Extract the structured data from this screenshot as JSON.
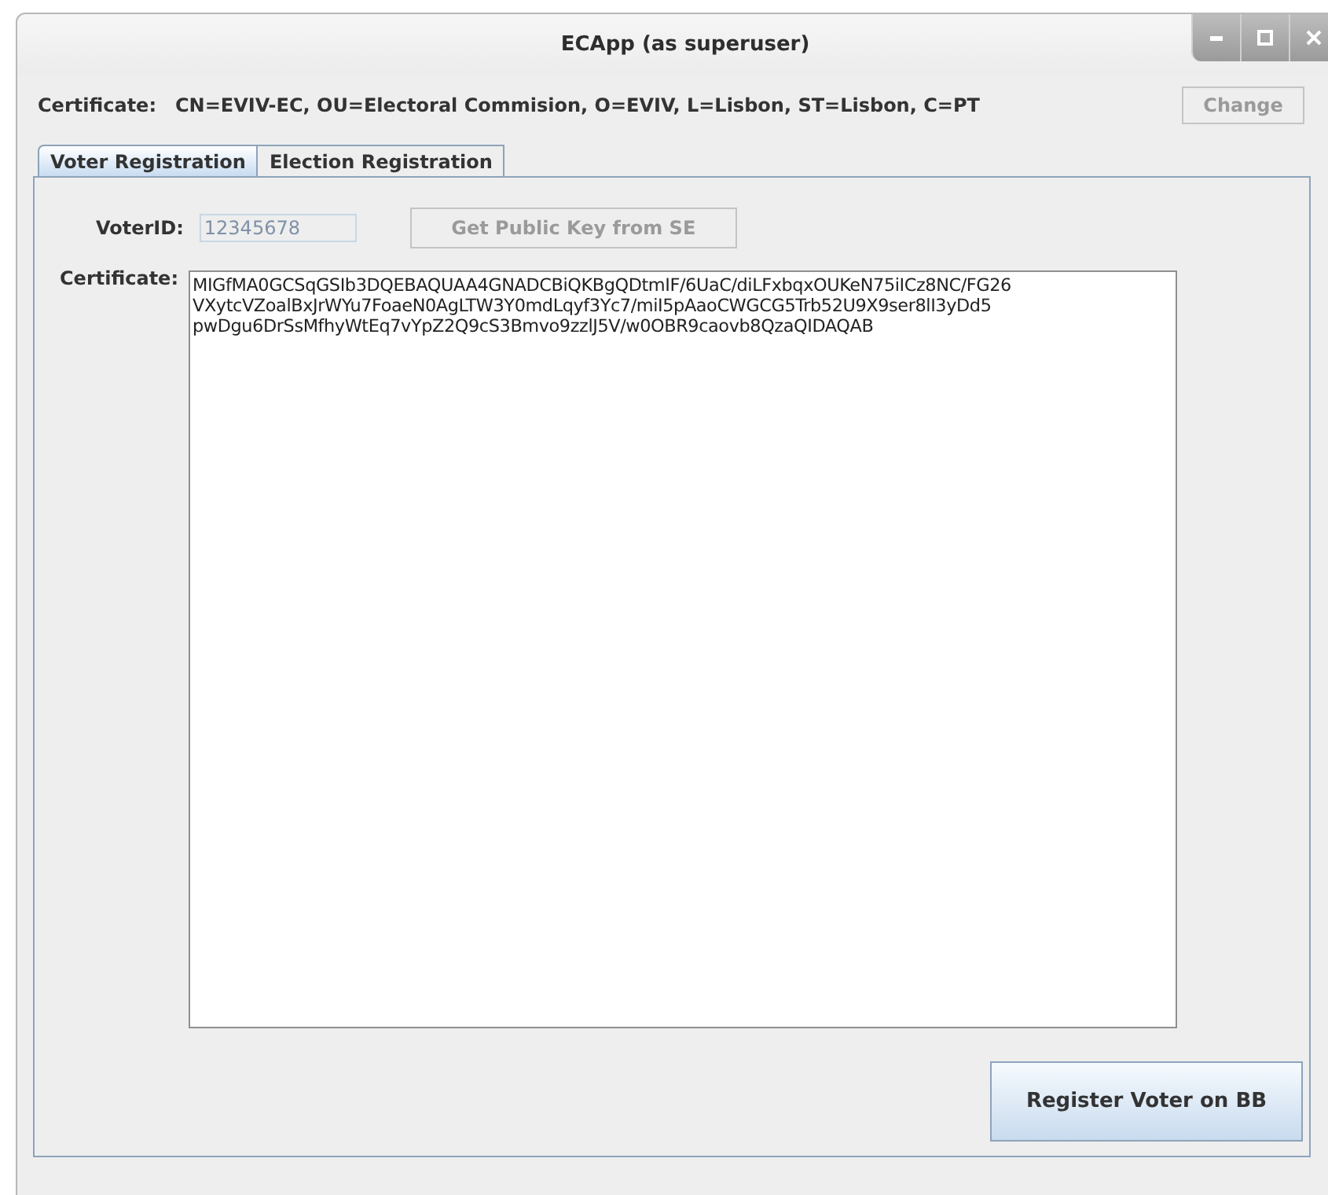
{
  "window": {
    "title": "ECApp (as superuser)"
  },
  "certificate_bar": {
    "label": "Certificate:",
    "value": "CN=EVIV-EC, OU=Electoral Commision, O=EVIV, L=Lisbon, ST=Lisbon, C=PT",
    "button": {
      "label": "Change",
      "disabled": true
    }
  },
  "tabs": [
    {
      "label": "Voter Registration",
      "selected": true
    },
    {
      "label": "Election Registration",
      "selected": false
    }
  ],
  "voter_id": {
    "label": "VoterID:",
    "value": "12345678",
    "disabled": true
  },
  "get_key_button": {
    "label": "Get Public Key from SE",
    "disabled": true
  },
  "certificate": {
    "label": "Certificate:",
    "lines": [
      "MIGfMA0GCSqGSIb3DQEBAQUAA4GNADCBiQKBgQDtmIF/6UaC/diLFxbqxOUKeN75iICz8NC/FG26",
      "VXytcVZoalBxJrWYu7FoaeN0AgLTW3Y0mdLqyf3Yc7/miI5pAaoCWGCG5Trb52U9X9ser8lI3yDd5",
      "pwDgu6DrSsMfhyWtEq7vYpZ2Q9cS3Bmvo9zzlJ5V/w0OBR9caovb8QzaQIDAQAB"
    ]
  },
  "register_button": {
    "label": "Register Voter on BB",
    "disabled": false
  }
}
